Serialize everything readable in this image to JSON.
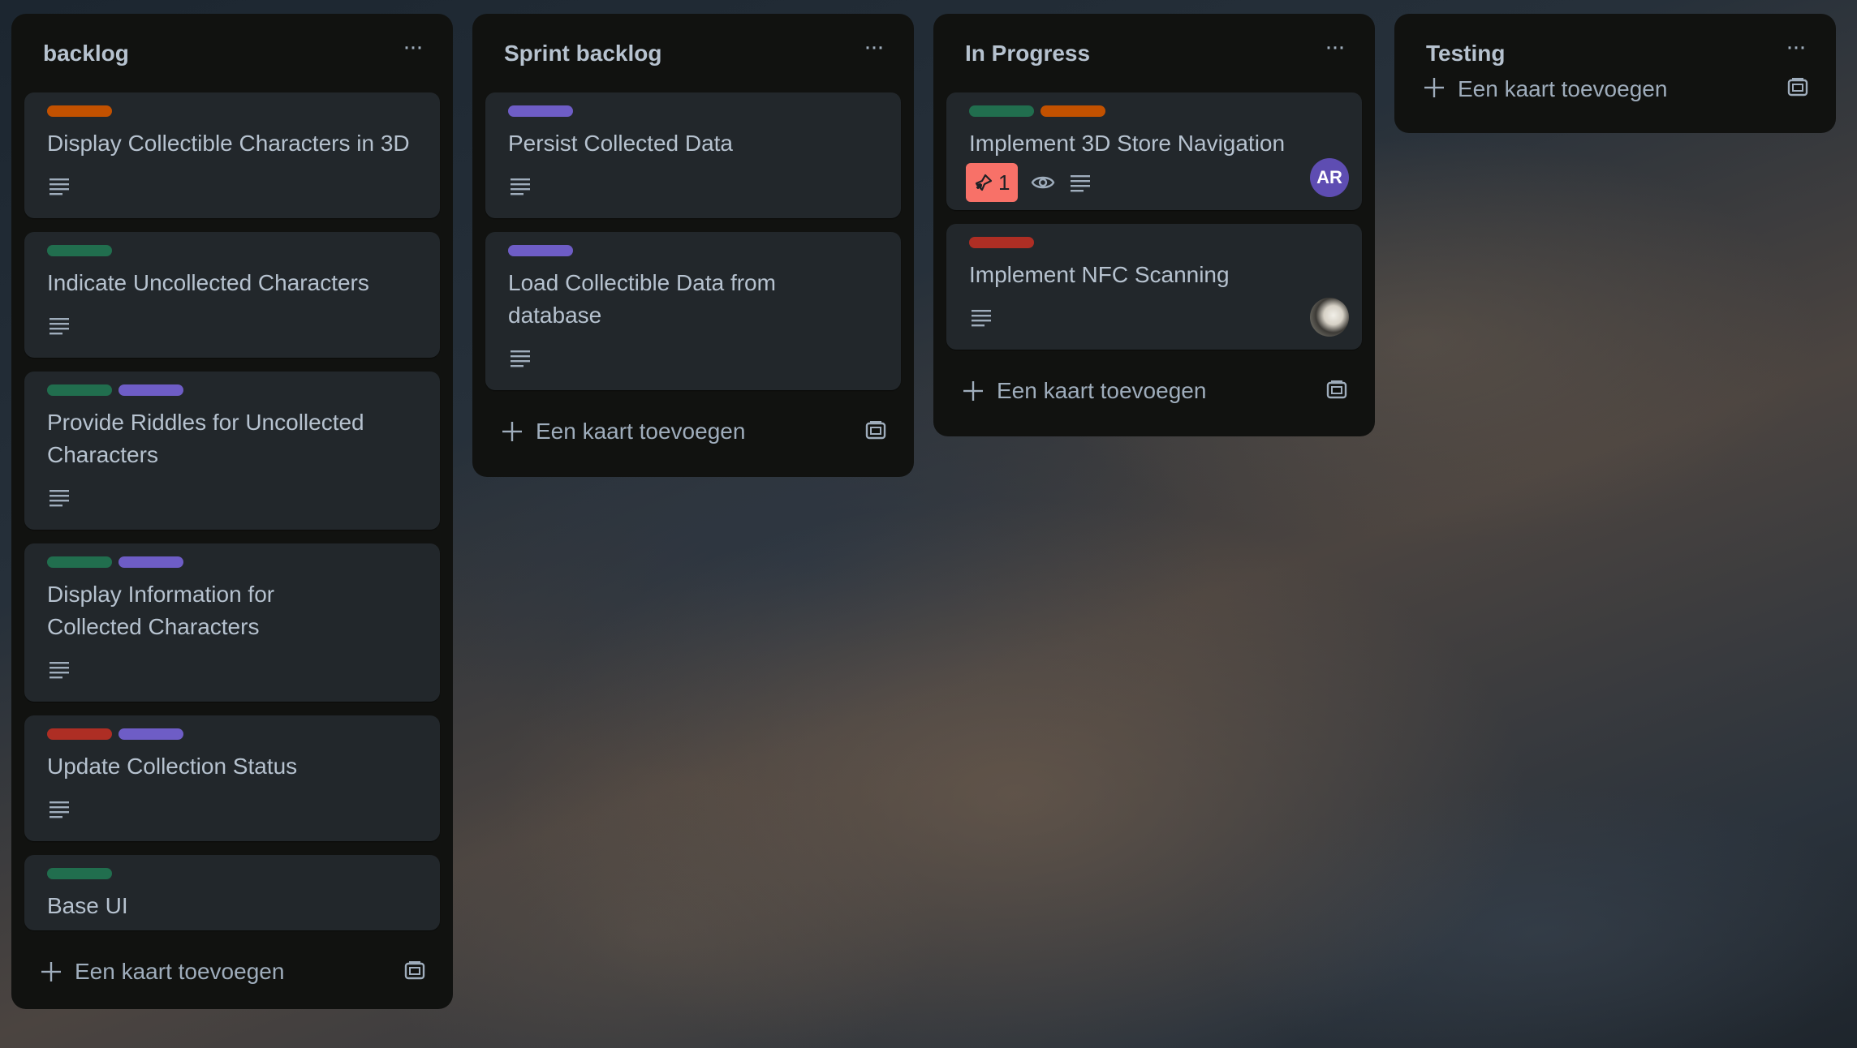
{
  "colors": {
    "column_bg": "#111210",
    "card_bg": "#22272b",
    "text": "#b6c2cf",
    "subtle_text": "#9fadbc",
    "label_orange": "#c25100",
    "label_green": "#216e4e",
    "label_purple": "#6e5dc6",
    "label_red": "#ae2e24",
    "notification_badge": "#f87168",
    "avatar_ar": "#5e4db2"
  },
  "add_card_label": "Een kaart toevoegen",
  "columns": [
    {
      "title": "backlog",
      "menu_icon": "more-horizontal-icon",
      "cards": [
        {
          "title": "Display Collectible Characters in 3D",
          "labels": [
            "orange"
          ],
          "has_description": true
        },
        {
          "title": "Indicate Uncollected Characters",
          "labels": [
            "green"
          ],
          "has_description": true
        },
        {
          "title": "Provide Riddles for Uncollected Characters",
          "labels": [
            "green",
            "purple"
          ],
          "has_description": true
        },
        {
          "title": "Display Information for Collected Characters",
          "labels": [
            "green",
            "purple"
          ],
          "has_description": true
        },
        {
          "title": "Update Collection Status",
          "labels": [
            "red",
            "purple"
          ],
          "has_description": true
        },
        {
          "title": "Base UI",
          "labels": [
            "green"
          ],
          "has_description": false
        }
      ]
    },
    {
      "title": "Sprint backlog",
      "menu_icon": "more-horizontal-icon",
      "cards": [
        {
          "title": "Persist Collected Data",
          "labels": [
            "purple"
          ],
          "has_description": true
        },
        {
          "title": "Load Collectible Data from database",
          "labels": [
            "purple"
          ],
          "has_description": true
        }
      ]
    },
    {
      "title": "In Progress",
      "menu_icon": "more-horizontal-icon",
      "cards": [
        {
          "title": "Implement 3D Store Navigation",
          "labels": [
            "green",
            "orange"
          ],
          "has_description": true,
          "notification_count": "1",
          "watching": true,
          "member_initials": "AR"
        },
        {
          "title": "Implement NFC Scanning",
          "labels": [
            "red"
          ],
          "has_description": true,
          "member_photo": true
        }
      ]
    },
    {
      "title": "Testing",
      "menu_icon": "more-horizontal-icon",
      "cards": []
    }
  ]
}
